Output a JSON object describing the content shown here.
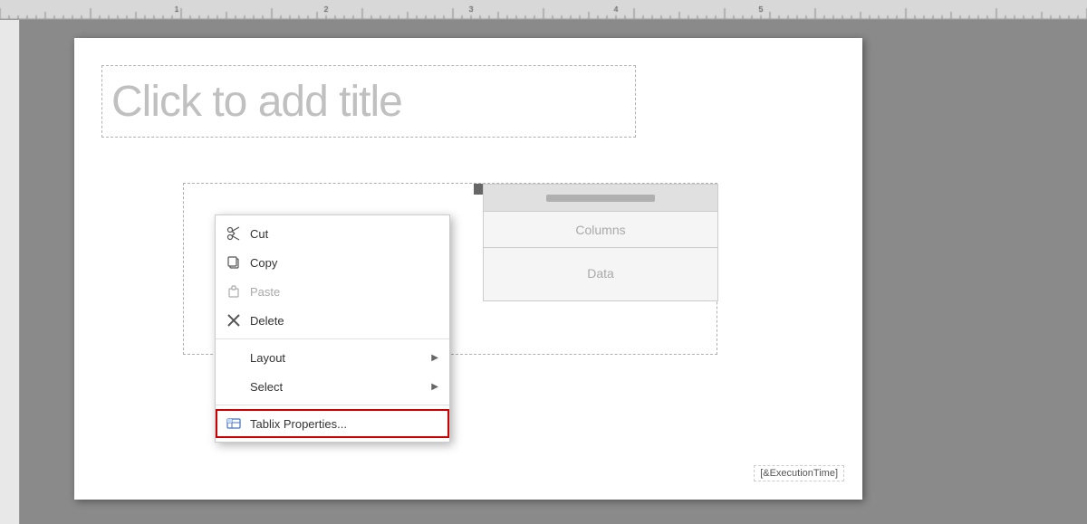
{
  "ruler": {
    "marks": [
      "1",
      "2",
      "3",
      "4",
      "5"
    ]
  },
  "page": {
    "title_placeholder": "Click to add title"
  },
  "tablix": {
    "columns_label": "Columns",
    "data_label": "Data",
    "execution_time": "[&ExecutionTime]"
  },
  "context_menu": {
    "items": [
      {
        "id": "cut",
        "label": "Cut",
        "icon": "scissors",
        "has_arrow": false,
        "disabled": false
      },
      {
        "id": "copy",
        "label": "Copy",
        "icon": "copy",
        "has_arrow": false,
        "disabled": false
      },
      {
        "id": "paste",
        "label": "Paste",
        "icon": "paste",
        "has_arrow": false,
        "disabled": true
      },
      {
        "id": "delete",
        "label": "Delete",
        "icon": "x",
        "has_arrow": false,
        "disabled": false
      },
      {
        "id": "layout",
        "label": "Layout",
        "icon": "",
        "has_arrow": true,
        "disabled": false
      },
      {
        "id": "select",
        "label": "Select",
        "icon": "",
        "has_arrow": true,
        "disabled": false
      },
      {
        "id": "tablix-properties",
        "label": "Tablix Properties...",
        "icon": "tablix",
        "has_arrow": false,
        "disabled": false,
        "highlighted": true
      }
    ]
  }
}
